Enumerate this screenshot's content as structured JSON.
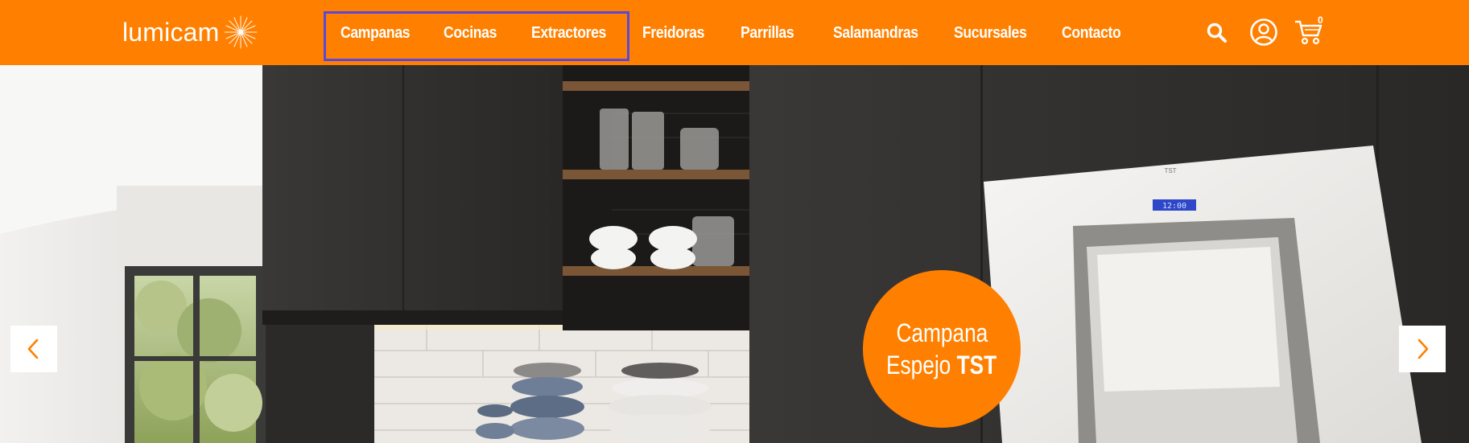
{
  "brand": {
    "name": "lumicam",
    "accent": "#FF8000",
    "highlight_outline": "#5A48D6"
  },
  "nav": {
    "items": [
      {
        "label": "Campanas"
      },
      {
        "label": "Cocinas"
      },
      {
        "label": "Extractores"
      },
      {
        "label": "Freidoras"
      },
      {
        "label": "Parrillas"
      },
      {
        "label": "Salamandras"
      },
      {
        "label": "Sucursales"
      },
      {
        "label": "Contacto"
      }
    ]
  },
  "header_icons": {
    "search": "search-icon",
    "account": "user-circle-icon",
    "cart": "cart-icon",
    "cart_count": "0"
  },
  "hero": {
    "badge_line1": "Campana",
    "badge_line2_prefix": "Espejo",
    "badge_line2_strong": "TST",
    "hood_display": "12:00",
    "hood_brand": "TST",
    "prev_icon": "chevron-left-icon",
    "next_icon": "chevron-right-icon"
  }
}
